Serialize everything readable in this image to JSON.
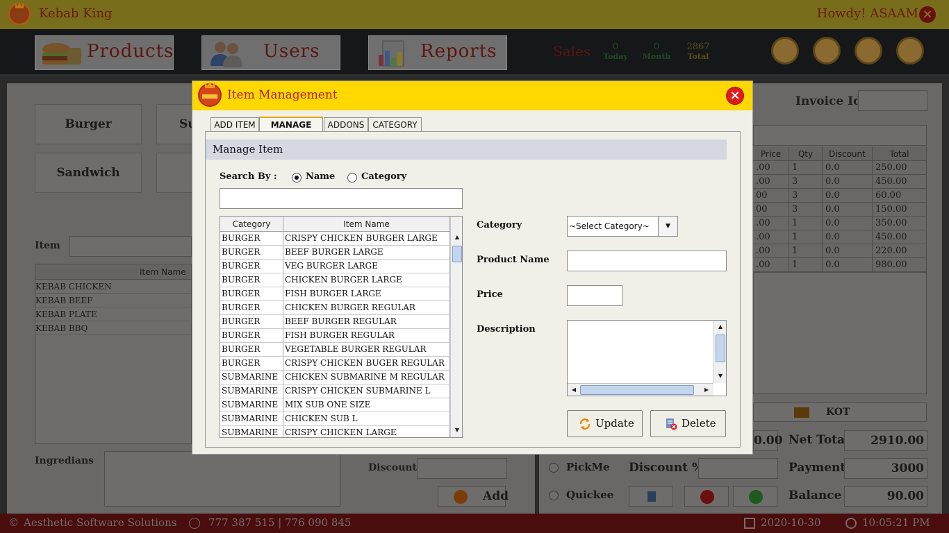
{
  "app": {
    "title": "Kebab King",
    "greeting": "Howdy! ASAAM"
  },
  "nav": {
    "products_label": "Products",
    "users_label": "Users",
    "reports_label": "Reports",
    "sales_label": "Sales",
    "stats": [
      {
        "value": "0",
        "label": "Today"
      },
      {
        "value": "0",
        "label": "Month"
      },
      {
        "value": "2867",
        "label": "Total"
      }
    ],
    "icons": [
      "calculator-icon",
      "notebook-icon",
      "chef-icon",
      "monitor-icon"
    ]
  },
  "background": {
    "categories": [
      "Burger",
      "Su",
      "Sandwich",
      ""
    ],
    "item_label": "Item",
    "items_header": "Item Name",
    "items": [
      "KEBAB CHICKEN",
      "KEBAB BEEF",
      "KEBAB PLATE",
      "KEBAB BBQ"
    ],
    "ingredients_label": "Ingredians",
    "discount_label": "Discount",
    "add_label": "Add",
    "invoice_label": "Invoice Id",
    "invoice_headers": [
      "Price",
      "Qty",
      "Discount",
      "Total"
    ],
    "invoice_rows": [
      [
        ".00",
        "1",
        "0.0",
        "250.00"
      ],
      [
        ".00",
        "3",
        "0.0",
        "450.00"
      ],
      [
        "00",
        "3",
        "0.0",
        "60.00"
      ],
      [
        "00",
        "3",
        "0.0",
        "150.00"
      ],
      [
        ".00",
        "1",
        "0.0",
        "350.00"
      ],
      [
        ".00",
        "1",
        "0.0",
        "450.00"
      ],
      [
        ".00",
        "1",
        "0.0",
        "220.00"
      ],
      [
        ".00",
        "1",
        "0.0",
        "980.00"
      ]
    ],
    "kot_label": "KOT",
    "subtotal_partial": "0.00",
    "net_total_label": "Net Total",
    "net_total_value": "2910.00",
    "pickme_label": "PickMe",
    "quickee_label": "Quickee",
    "discount_pct_label": "Discount %",
    "payment_label": "Payment",
    "payment_value": "3000",
    "balance_label": "Balance",
    "balance_value": "90.00"
  },
  "status": {
    "company": "Aesthetic Software Solutions",
    "phone": "777 387 515 | 776 090 845",
    "date": "2020-10-30",
    "time": "10:05:21 PM"
  },
  "modal": {
    "title": "Item Management",
    "tabs": [
      "ADD ITEM",
      "MANAGE ITEM",
      "ADDONS",
      "CATEGORY"
    ],
    "active_tab": "MANAGE ITEM",
    "section_title": "Manage Item",
    "search_by_label": "Search By :",
    "radio_name": "Name",
    "radio_category": "Category",
    "search_value": "",
    "grid_headers": [
      "Category",
      "Item Name"
    ],
    "grid_rows": [
      [
        "BURGER",
        "CRISPY CHICKEN BURGER LARGE"
      ],
      [
        "BURGER",
        "BEEF BURGER LARGE"
      ],
      [
        "BURGER",
        "VEG BURGER LARGE"
      ],
      [
        "BURGER",
        "CHICKEN BURGER LARGE"
      ],
      [
        "BURGER",
        "FISH BURGER LARGE"
      ],
      [
        "BURGER",
        "CHICKEN BURGER REGULAR"
      ],
      [
        "BURGER",
        "BEEF BURGER REGULAR"
      ],
      [
        "BURGER",
        "FISH BURGER REGULAR"
      ],
      [
        "BURGER",
        "VEGETABLE BURGER REGULAR"
      ],
      [
        "BURGER",
        "CRISPY CHICKEN BUGER REGULAR"
      ],
      [
        "SUBMARINE",
        "CHICKEN SUBMARINE M REGULAR"
      ],
      [
        "SUBMARINE",
        "CRISPY CHICKEN SUBMARINE L"
      ],
      [
        "SUBMARINE",
        "MIX SUB ONE SIZE"
      ],
      [
        "SUBMARINE",
        "CHICKEN SUB L"
      ],
      [
        "SUBMARINE",
        "CRISPY CHICKEN LARGE"
      ]
    ],
    "category_label": "Category",
    "category_select": "~Select Category~",
    "product_name_label": "Product Name",
    "product_name_value": "",
    "price_label": "Price",
    "price_value": "",
    "description_label": "Description",
    "description_value": "",
    "update_label": "Update",
    "delete_label": "Delete"
  }
}
